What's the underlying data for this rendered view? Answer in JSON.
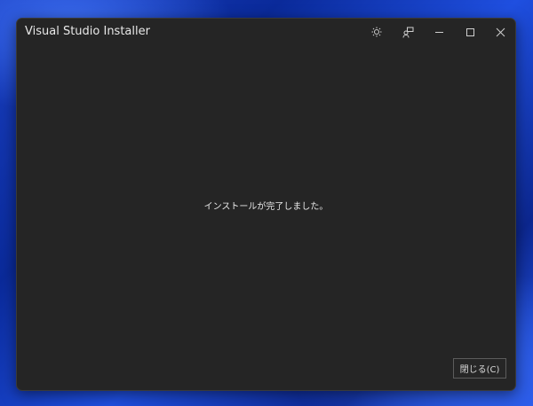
{
  "window": {
    "title": "Visual Studio Installer"
  },
  "titlebar": {
    "icons": [
      "theme-brightness-icon",
      "feedback-icon",
      "minimize-icon",
      "maximize-icon",
      "close-icon"
    ]
  },
  "main": {
    "message": "インストールが完了しました。"
  },
  "footer": {
    "close_label": "閉じる(C)"
  }
}
